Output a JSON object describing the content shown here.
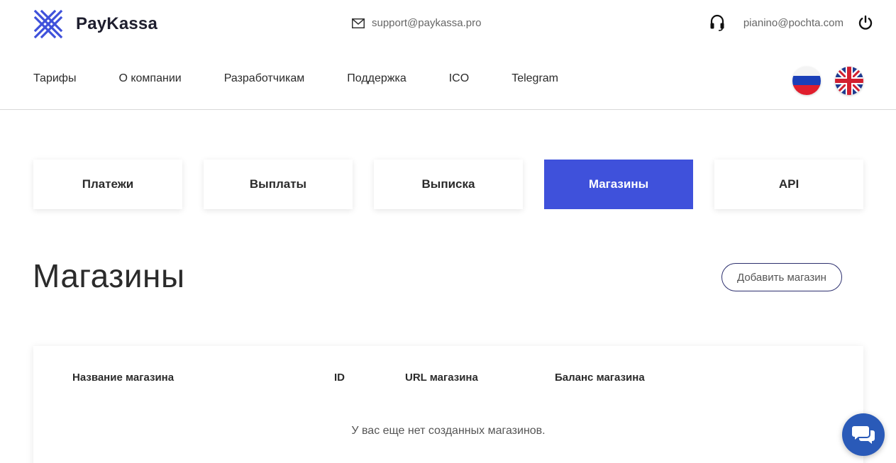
{
  "brand": {
    "name": "PayKassa",
    "accent": "#3f51db"
  },
  "header": {
    "support_email": "support@paykassa.pro",
    "user_email": "pianino@pochta.com"
  },
  "nav": {
    "items": [
      {
        "label": "Тарифы"
      },
      {
        "label": "О компании"
      },
      {
        "label": "Разработчикам"
      },
      {
        "label": "Поддержка"
      },
      {
        "label": "ICO"
      },
      {
        "label": "Telegram"
      }
    ]
  },
  "languages": [
    "ru-flag-icon",
    "uk-flag-icon"
  ],
  "tabs": [
    {
      "label": "Платежи",
      "active": false
    },
    {
      "label": "Выплаты",
      "active": false
    },
    {
      "label": "Выписка",
      "active": false
    },
    {
      "label": "Магазины",
      "active": true
    },
    {
      "label": "API",
      "active": false
    }
  ],
  "page": {
    "title": "Магазины",
    "add_button": "Добавить магазин"
  },
  "table": {
    "columns": [
      "Название магазина",
      "ID",
      "URL магазина",
      "Баланс магазина"
    ],
    "empty_text": "У вас еще нет созданных магазинов."
  }
}
